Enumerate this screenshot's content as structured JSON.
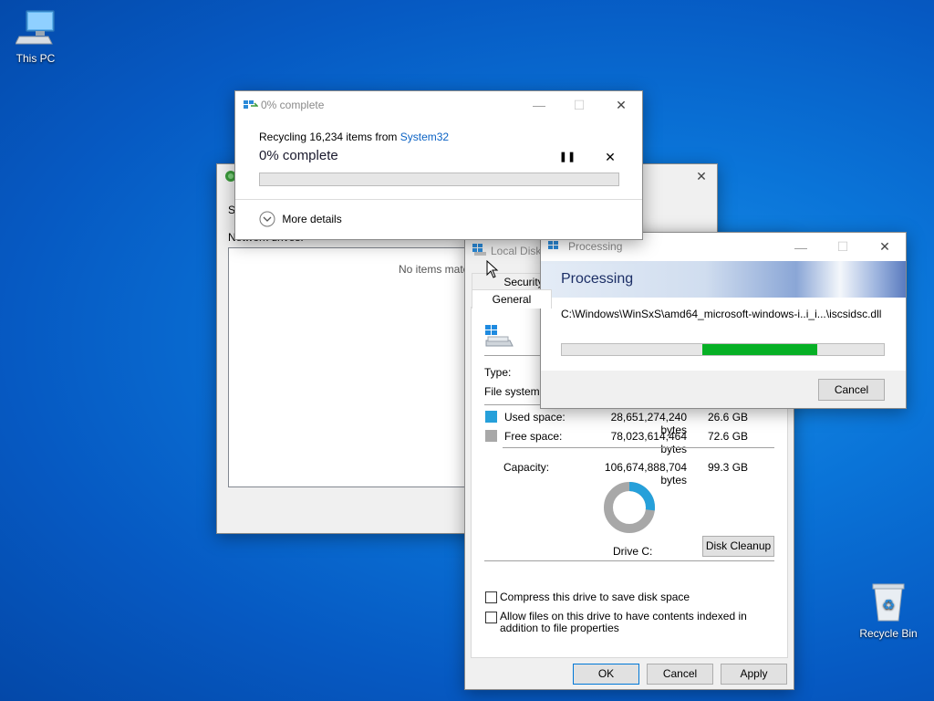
{
  "desktop": {
    "this_pc_label": "This PC",
    "recycle_bin_label": "Recycle Bin"
  },
  "background_window": {
    "title_initial": "S",
    "section_label": "Network drives:",
    "empty_text": "No items match"
  },
  "recycle_dialog": {
    "title": "0% complete",
    "status_prefix": "Recycling 16,234 items from ",
    "status_link": "System32",
    "percent_text": "0% complete",
    "progress_percent": 0,
    "more_details_label": "More details"
  },
  "properties_dialog": {
    "title": "Local Disk (C:) Properties",
    "tabs": {
      "security": "Security",
      "general": "General"
    },
    "type_label": "Type:",
    "filesystem_label": "File system:",
    "used_label": "Used space:",
    "used_bytes": "28,651,274,240 bytes",
    "used_gb": "26.6 GB",
    "free_label": "Free space:",
    "free_bytes": "78,023,614,464 bytes",
    "free_gb": "72.6 GB",
    "capacity_label": "Capacity:",
    "capacity_bytes": "106,674,888,704 bytes",
    "capacity_gb": "99.3 GB",
    "drive_label": "Drive C:",
    "used_fraction": 0.269,
    "disk_cleanup_label": "Disk Cleanup",
    "compress_label": "Compress this drive to save disk space",
    "index_label": "Allow files on this drive to have contents indexed in addition to file properties",
    "ok_label": "OK",
    "cancel_label": "Cancel",
    "apply_label": "Apply",
    "colors": {
      "used": "#26a0da",
      "free": "#a8a8a8"
    }
  },
  "processing_dialog": {
    "title": "Processing",
    "header": "Processing",
    "path": "C:\\Windows\\WinSxS\\amd64_microsoft-windows-i..i_i...\\iscsidsc.dll",
    "cancel_label": "Cancel",
    "progress_color": "#06b025"
  }
}
